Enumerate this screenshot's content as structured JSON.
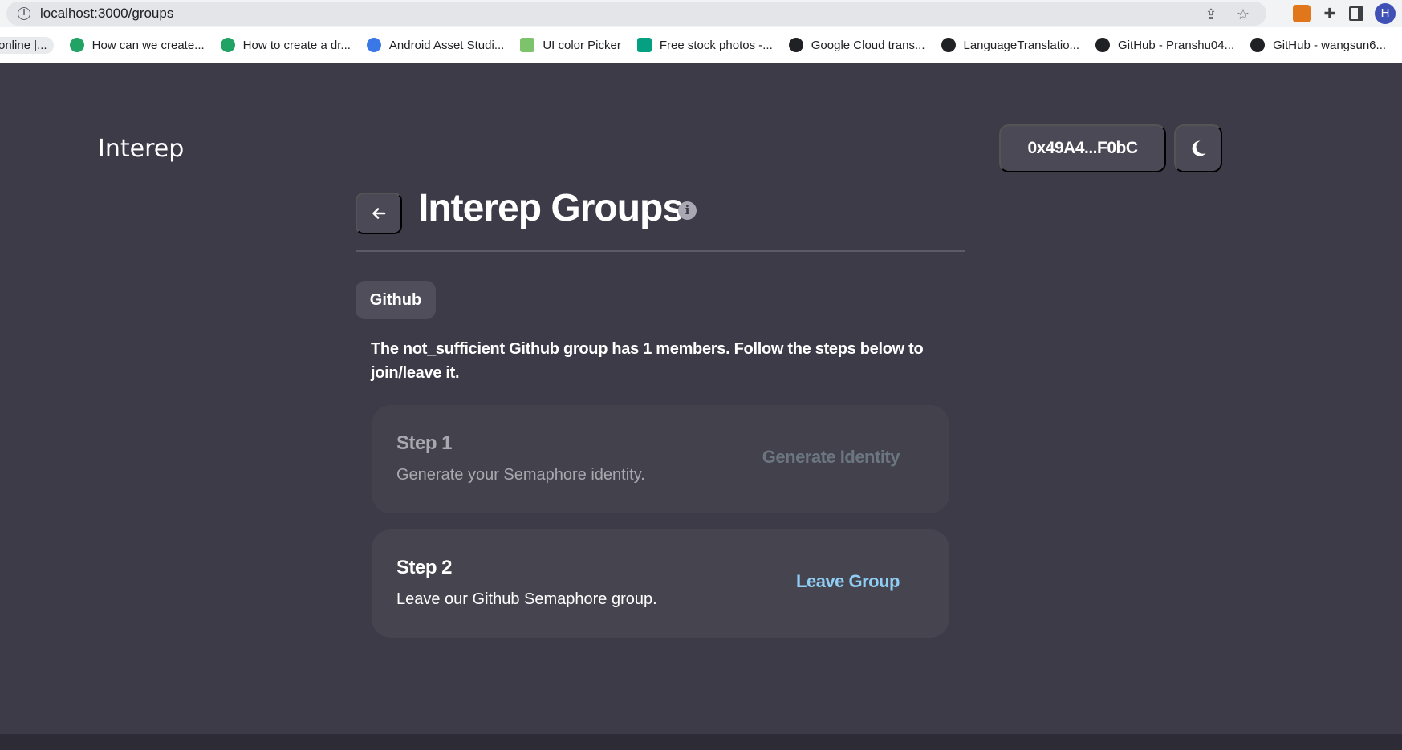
{
  "browser": {
    "url": "localhost:3000/groups",
    "avatar_initial": "H",
    "bookmarks": [
      {
        "label": "online |...",
        "icon": "blank-page-icon"
      },
      {
        "label": "How can we create...",
        "icon": "green-link-icon"
      },
      {
        "label": "How to create a dr...",
        "icon": "green-link-icon"
      },
      {
        "label": "Android Asset Studi...",
        "icon": "blue-compass-icon"
      },
      {
        "label": "UI color Picker",
        "icon": "color-picker-icon"
      },
      {
        "label": "Free stock photos -...",
        "icon": "photo-icon"
      },
      {
        "label": "Google Cloud trans...",
        "icon": "globe-icon"
      },
      {
        "label": "LanguageTranslatio...",
        "icon": "github-icon"
      },
      {
        "label": "GitHub - Pranshu04...",
        "icon": "github-icon"
      },
      {
        "label": "GitHub - wangsun6...",
        "icon": "github-icon"
      }
    ]
  },
  "app": {
    "logo": "Interep",
    "wallet_address": "0x49A4...F0bC",
    "theme_icon": "moon-icon"
  },
  "page": {
    "title": "Interep Groups",
    "provider_tag": "Github",
    "description": "The not_sufficient Github group has 1 members. Follow the steps below to join/leave it."
  },
  "steps": [
    {
      "title": "Step 1",
      "subtitle": "Generate your Semaphore identity.",
      "action": "Generate Identity",
      "enabled": false
    },
    {
      "title": "Step 2",
      "subtitle": "Leave our Github Semaphore group.",
      "action": "Leave Group",
      "enabled": true
    }
  ],
  "colors": {
    "background": "#3c3b47",
    "card": "#45444f",
    "accent": "#90cdf4",
    "disabled": "#6c7680"
  }
}
